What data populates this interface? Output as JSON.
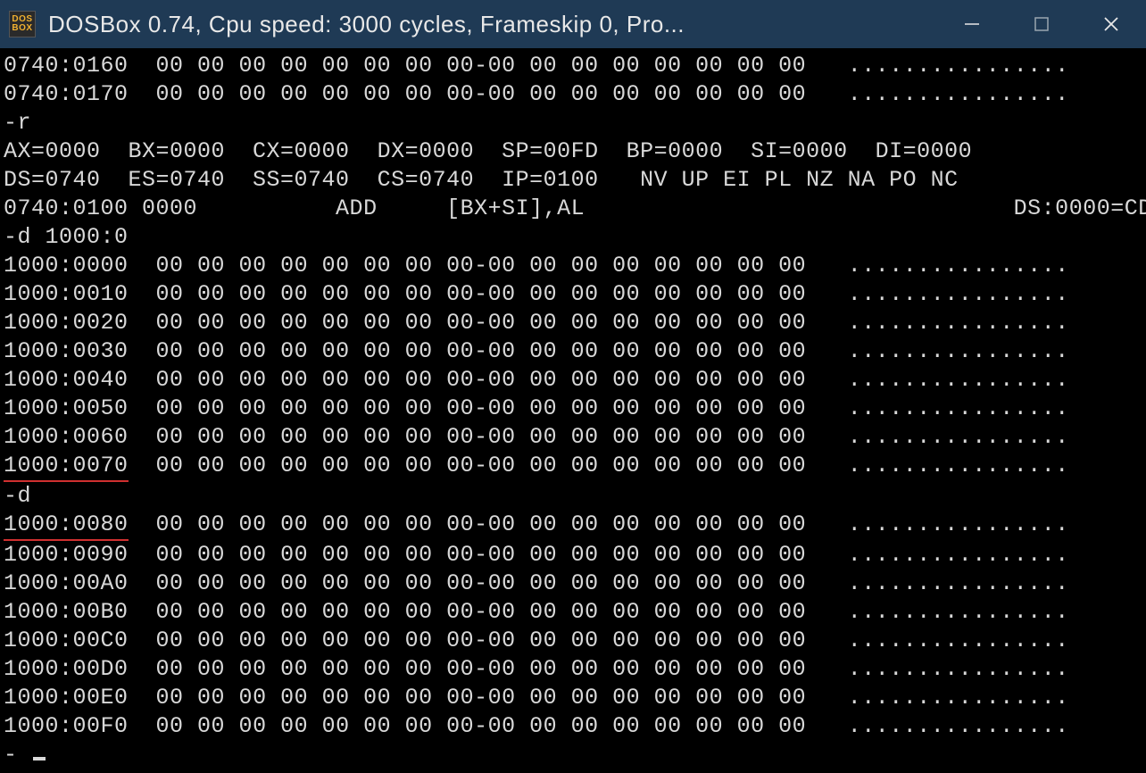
{
  "titlebar": {
    "icon_lines": [
      "DOS",
      "BOX"
    ],
    "title": "DOSBox 0.74, Cpu speed:    3000 cycles, Frameskip  0, Pro..."
  },
  "terminal": {
    "hex_ascii": "................",
    "dump_top": [
      {
        "addr": "0740:0160",
        "bytes": "00 00 00 00 00 00 00 00-00 00 00 00 00 00 00 00"
      },
      {
        "addr": "0740:0170",
        "bytes": "00 00 00 00 00 00 00 00-00 00 00 00 00 00 00 00"
      }
    ],
    "cmd_r": "-r",
    "regs_line1": "AX=0000  BX=0000  CX=0000  DX=0000  SP=00FD  BP=0000  SI=0000  DI=0000",
    "regs_line2": "DS=0740  ES=0740  SS=0740  CS=0740  IP=0100   NV UP EI PL NZ NA PO NC",
    "disasm_addr": "0740:0100",
    "disasm_opcode": "0000",
    "disasm_mnemonic": "ADD",
    "disasm_operands": "[BX+SI],AL",
    "disasm_ds": "DS:0000=CD",
    "cmd_d1": "-d 1000:0",
    "dump1": [
      {
        "addr": "1000:0000",
        "bytes": "00 00 00 00 00 00 00 00-00 00 00 00 00 00 00 00"
      },
      {
        "addr": "1000:0010",
        "bytes": "00 00 00 00 00 00 00 00-00 00 00 00 00 00 00 00"
      },
      {
        "addr": "1000:0020",
        "bytes": "00 00 00 00 00 00 00 00-00 00 00 00 00 00 00 00"
      },
      {
        "addr": "1000:0030",
        "bytes": "00 00 00 00 00 00 00 00-00 00 00 00 00 00 00 00"
      },
      {
        "addr": "1000:0040",
        "bytes": "00 00 00 00 00 00 00 00-00 00 00 00 00 00 00 00"
      },
      {
        "addr": "1000:0050",
        "bytes": "00 00 00 00 00 00 00 00-00 00 00 00 00 00 00 00"
      },
      {
        "addr": "1000:0060",
        "bytes": "00 00 00 00 00 00 00 00-00 00 00 00 00 00 00 00"
      },
      {
        "addr": "1000:0070",
        "bytes": "00 00 00 00 00 00 00 00-00 00 00 00 00 00 00 00",
        "underline": true
      }
    ],
    "cmd_d2": "-d",
    "dump2": [
      {
        "addr": "1000:0080",
        "bytes": "00 00 00 00 00 00 00 00-00 00 00 00 00 00 00 00",
        "underline": true
      },
      {
        "addr": "1000:0090",
        "bytes": "00 00 00 00 00 00 00 00-00 00 00 00 00 00 00 00"
      },
      {
        "addr": "1000:00A0",
        "bytes": "00 00 00 00 00 00 00 00-00 00 00 00 00 00 00 00"
      },
      {
        "addr": "1000:00B0",
        "bytes": "00 00 00 00 00 00 00 00-00 00 00 00 00 00 00 00"
      },
      {
        "addr": "1000:00C0",
        "bytes": "00 00 00 00 00 00 00 00-00 00 00 00 00 00 00 00"
      },
      {
        "addr": "1000:00D0",
        "bytes": "00 00 00 00 00 00 00 00-00 00 00 00 00 00 00 00"
      },
      {
        "addr": "1000:00E0",
        "bytes": "00 00 00 00 00 00 00 00-00 00 00 00 00 00 00 00"
      },
      {
        "addr": "1000:00F0",
        "bytes": "00 00 00 00 00 00 00 00-00 00 00 00 00 00 00 00"
      }
    ],
    "prompt": "- "
  }
}
